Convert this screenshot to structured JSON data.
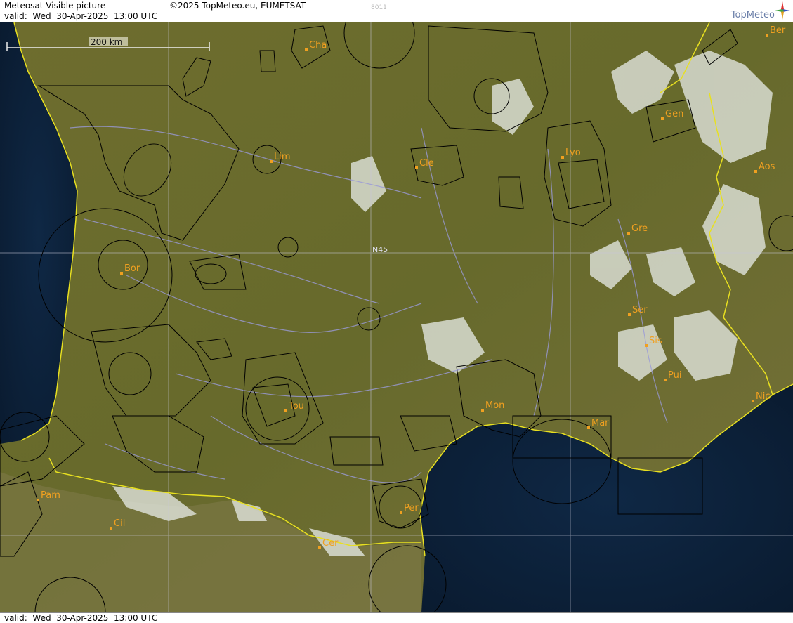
{
  "header": {
    "title": "Meteosat Visible picture",
    "valid": "valid:  Wed  30-Apr-2025  13:00 UTC",
    "copyright": "©2025 TopMeteo.eu, EUMETSAT",
    "code": "8011",
    "logo": "TopMeteo"
  },
  "scale": {
    "label": "200 km"
  },
  "lat_label": "N45",
  "cities": {
    "cha": "Cha",
    "lim": "Lim",
    "cle": "Cle",
    "lyo": "Lyo",
    "gen": "Gen",
    "ber": "Ber",
    "aos": "Aos",
    "gre": "Gre",
    "bor": "Bor",
    "ser": "Ser",
    "sis": "Sis",
    "pui": "Pui",
    "tou": "Tou",
    "mon": "Mon",
    "mar": "Mar",
    "nic": "Nic",
    "pam": "Pam",
    "cil": "Cil",
    "per": "Per",
    "cer": "Cer"
  },
  "footer": {
    "valid": "valid:  Wed  30-Apr-2025  13:00 UTC"
  },
  "colors": {
    "land": "#6b6a2a",
    "sea": "#10253f",
    "coast": "#e8e020",
    "city": "#f0a020",
    "airspace": "#000000",
    "rivers": "#9a9ad8"
  }
}
